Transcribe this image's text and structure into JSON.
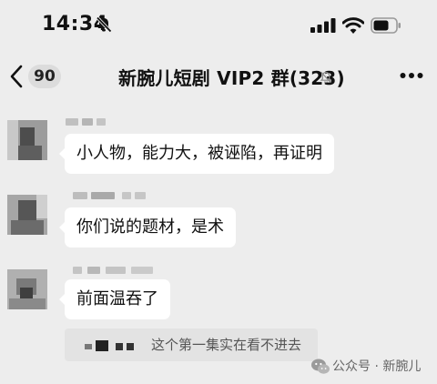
{
  "status_bar": {
    "time": "14:34",
    "icons": [
      "bell-slash-icon",
      "cellular-signal-icon",
      "wifi-icon",
      "battery-icon"
    ]
  },
  "nav": {
    "unread_count": "90",
    "title": "新腕儿短剧 VIP2 群",
    "member_count": "(323)",
    "icons": [
      "chevron-left-icon",
      "bell-slash-icon",
      "more-dots-icon"
    ]
  },
  "messages": [
    {
      "text": "小人物，能力大，被诬陷，再证明"
    },
    {
      "text": "你们说的题材，是术"
    },
    {
      "text": "前面温吞了"
    }
  ],
  "quote": {
    "text": "这个第一集实在看不进去"
  },
  "watermark": {
    "text": "公众号 · 新腕儿"
  },
  "colors": {
    "background": "#ededed",
    "bubble": "#ffffff",
    "quote_bg": "#e3e3e3"
  }
}
